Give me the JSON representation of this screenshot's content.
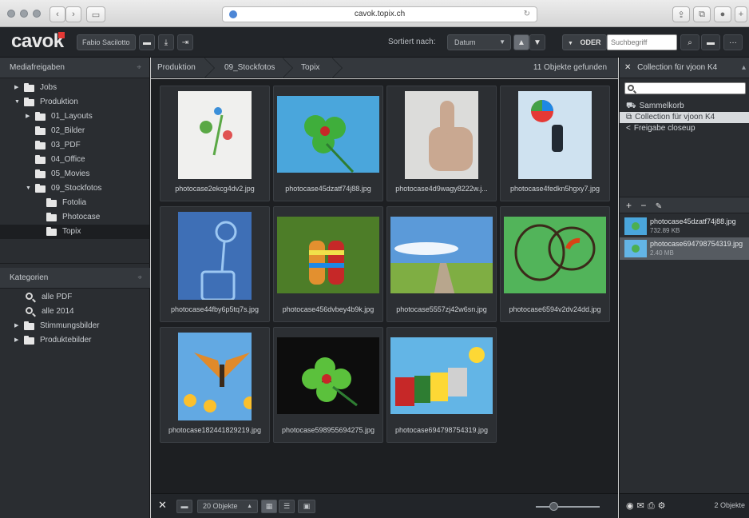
{
  "browser": {
    "url": "cavok.topix.ch",
    "reload_icon": "reload-icon"
  },
  "app": {
    "logo": "cavok",
    "user": "Fabio Sacilotto",
    "sort_label": "Sortiert nach:",
    "sort_value": "Datum",
    "oder_label": "ODER",
    "search_placeholder": "Suchbegriff"
  },
  "left": {
    "mediafreigaben_title": "Mediafreigaben",
    "tree": [
      {
        "label": "Jobs",
        "indent": 0,
        "expanded": false,
        "arrow": true
      },
      {
        "label": "Produktion",
        "indent": 0,
        "expanded": true,
        "arrow": true
      },
      {
        "label": "01_Layouts",
        "indent": 1,
        "expanded": false,
        "arrow": true
      },
      {
        "label": "02_Bilder",
        "indent": 1,
        "expanded": false,
        "arrow": false
      },
      {
        "label": "03_PDF",
        "indent": 1,
        "expanded": false,
        "arrow": false
      },
      {
        "label": "04_Office",
        "indent": 1,
        "expanded": false,
        "arrow": false
      },
      {
        "label": "05_Movies",
        "indent": 1,
        "expanded": false,
        "arrow": false
      },
      {
        "label": "09_Stockfotos",
        "indent": 1,
        "expanded": true,
        "arrow": true
      },
      {
        "label": "Fotolia",
        "indent": 2,
        "expanded": false,
        "arrow": false
      },
      {
        "label": "Photocase",
        "indent": 2,
        "expanded": false,
        "arrow": false
      },
      {
        "label": "Topix",
        "indent": 2,
        "expanded": false,
        "arrow": false,
        "selected": true
      }
    ],
    "kategorien_title": "Kategorien",
    "categories": [
      {
        "label": "alle PDF",
        "type": "search"
      },
      {
        "label": "alle 2014",
        "type": "search"
      },
      {
        "label": "Stimmungsbilder",
        "type": "folder"
      },
      {
        "label": "Produktebilder",
        "type": "folder"
      }
    ]
  },
  "breadcrumb": [
    "Produktion",
    "09_Stockfotos",
    "Topix"
  ],
  "result_count": "11 Objekte gefunden",
  "items": [
    {
      "name": "photocase2ekcg4dv2.jpg",
      "bg": "#f0f0ee",
      "fg": "#5aa845"
    },
    {
      "name": "photocase45dzatf74j88.jpg",
      "bg": "#4aa6dc",
      "fg": "#3fae3b"
    },
    {
      "name": "photocase4d9wagy8222w.j...",
      "bg": "#dcdcda",
      "fg": "#c9a891"
    },
    {
      "name": "photocase4fedkn5hgxy7.jpg",
      "bg": "#cfe2f0",
      "fg": "#222a33"
    },
    {
      "name": "photocase44fby6p5tq7s.jpg",
      "bg": "#3e6fb6",
      "fg": "#9cc7f2"
    },
    {
      "name": "photocase456dvbey4b9k.jpg",
      "bg": "#4d7d28",
      "fg": "#e3902f"
    },
    {
      "name": "photocase5557zj42w6sn.jpg",
      "bg": "#5b9ad9",
      "fg": "#7fae43"
    },
    {
      "name": "photocase6594v2dv24dd.jpg",
      "bg": "#52b45a",
      "fg": "#b8e0c0"
    },
    {
      "name": "photocase182441829219.jpg",
      "bg": "#62a9e3",
      "fg": "#e08a2a"
    },
    {
      "name": "photocase598955694275.jpg",
      "bg": "#0d0d0d",
      "fg": "#5bc13c"
    },
    {
      "name": "photocase694798754319.jpg",
      "bg": "#63b5e6",
      "fg": "#d0d0d0"
    }
  ],
  "bottom": {
    "objects_select": "20 Objekte",
    "zoom_level": 0.28
  },
  "right": {
    "collection_title": "Collection für vjoon K4",
    "collections": [
      {
        "label": "Sammelkorb",
        "selected": false
      },
      {
        "label": "Collection für vjoon K4",
        "selected": true
      },
      {
        "label": "Freigabe closeup",
        "selected": false
      }
    ],
    "files": [
      {
        "name": "photocase45dzatf74j88.jpg",
        "size": "732.89 KB",
        "selected": false,
        "bg": "#4aa6dc"
      },
      {
        "name": "photocase694798754319.jpg",
        "size": "2.40 MB",
        "selected": true,
        "bg": "#63b5e6"
      }
    ],
    "count": "2 Objekte"
  }
}
